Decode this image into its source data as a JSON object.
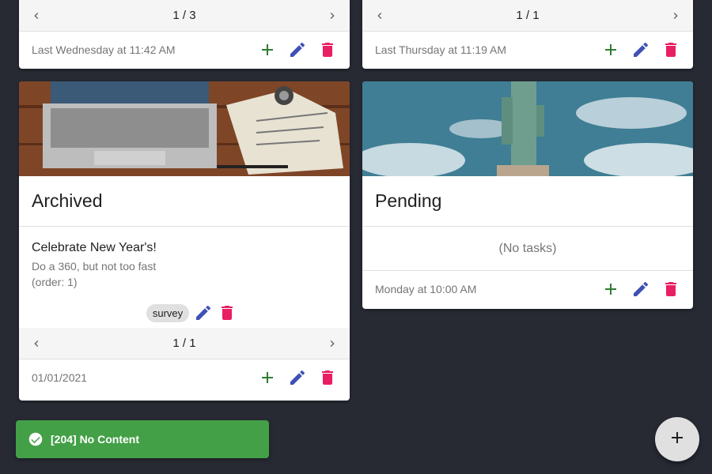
{
  "colors": {
    "add": "#2e7d32",
    "edit": "#3f51b5",
    "delete": "#e91e63",
    "snackbar": "#43a047",
    "fab": "#e0e0e0"
  },
  "cards": [
    {
      "pager": "1 / 3",
      "timestamp": "Last Wednesday at 11:42 AM"
    },
    {
      "pager": "1 / 1",
      "timestamp": "Last Thursday at 11:19 AM"
    },
    {
      "title": "Archived",
      "task": {
        "title": "Celebrate New Year's!",
        "description": "Do a 360, but not too fast",
        "order": "(order: 1)",
        "tag": "survey"
      },
      "pager": "1 / 1",
      "timestamp": "01/01/2021"
    },
    {
      "title": "Pending",
      "empty_text": "(No tasks)",
      "timestamp": "Monday at 10:00 AM"
    }
  ],
  "snackbar": {
    "message": "[204] No Content",
    "icon": "check-circle-icon"
  },
  "fab": {
    "icon": "plus-icon"
  }
}
